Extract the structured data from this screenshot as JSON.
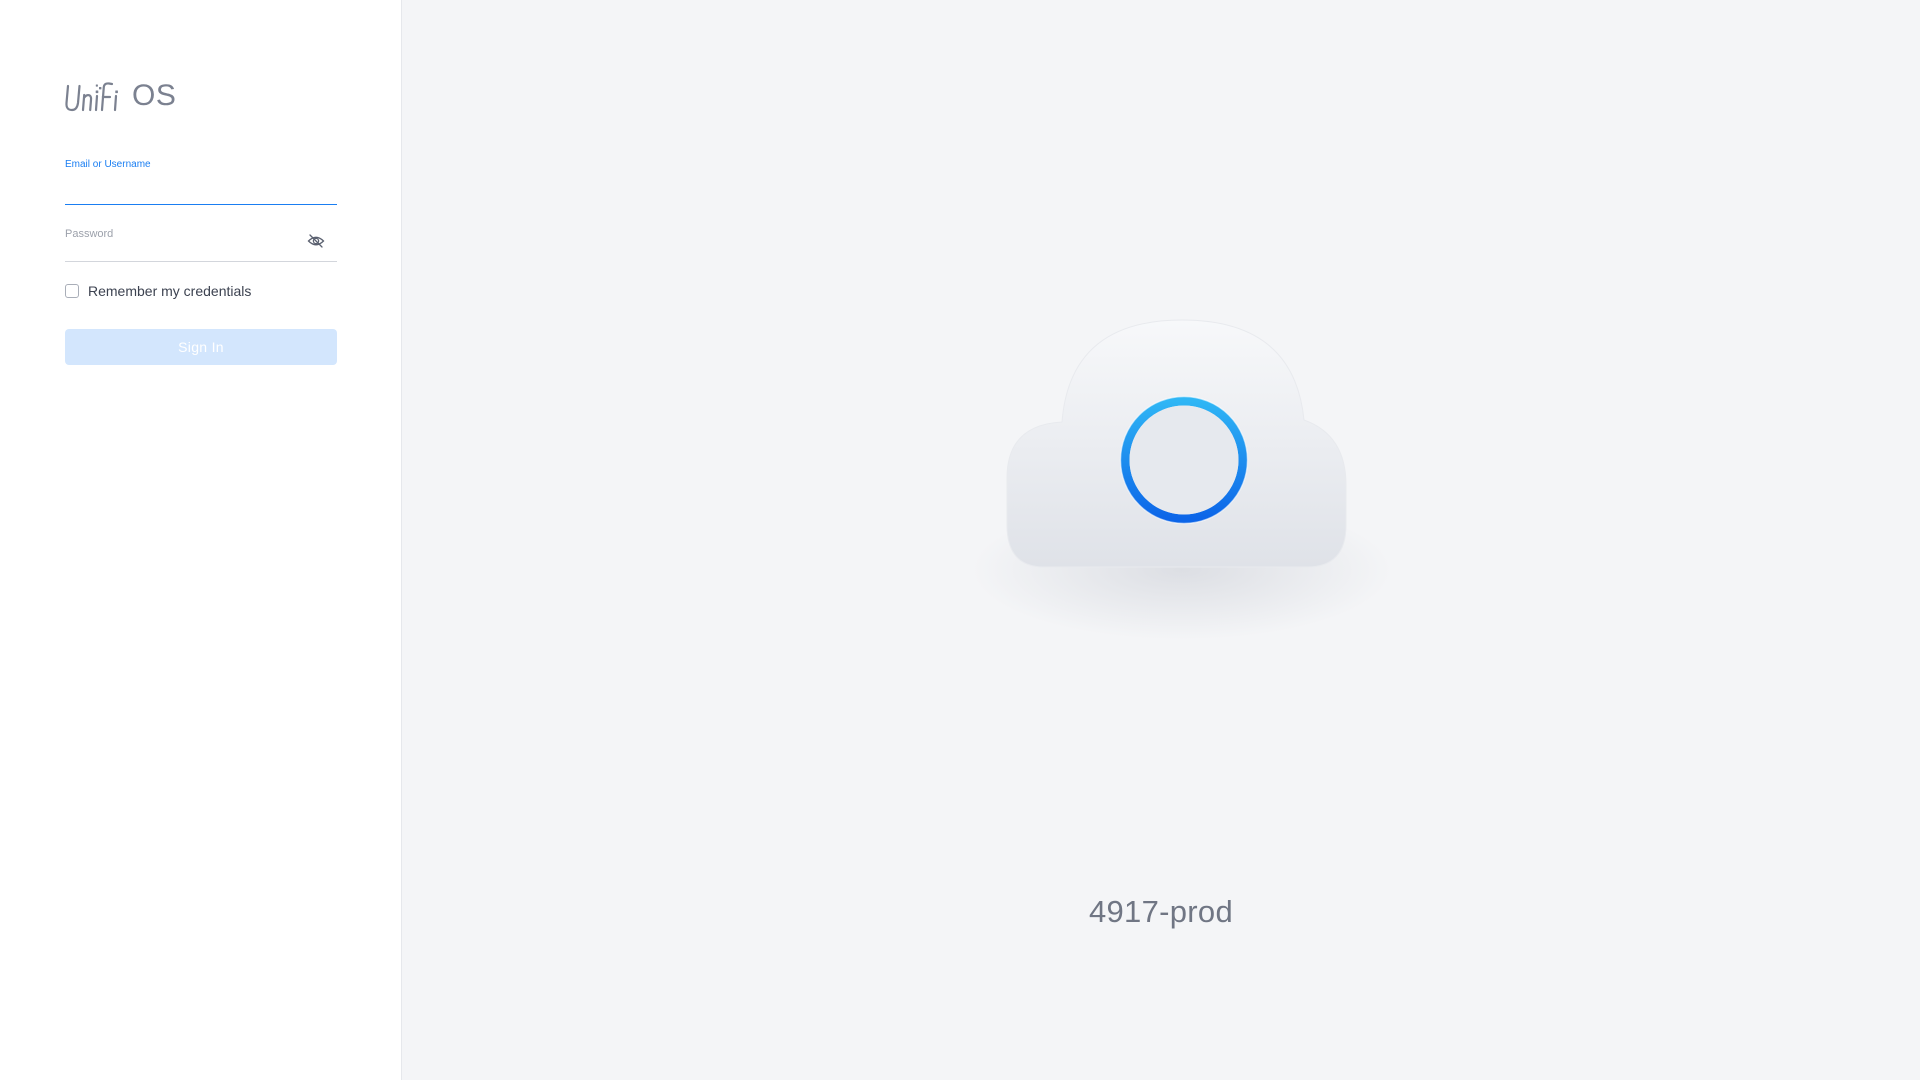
{
  "brand": {
    "logo_os_text": "OS"
  },
  "login_form": {
    "email": {
      "label": "Email or Username",
      "value": ""
    },
    "password": {
      "label": "Password",
      "value": "",
      "visibility_icon": "eye-slash-icon"
    },
    "remember": {
      "label": "Remember my credentials",
      "checked": false
    },
    "submit_label": "Sign In"
  },
  "main": {
    "illustration": "cloud-icon",
    "hostname": "4917-prod"
  },
  "colors": {
    "accent": "#1a7ef2",
    "button_disabled_bg": "#d3e6fd",
    "page_bg": "#f4f5f7",
    "sidebar_bg": "#ffffff"
  }
}
